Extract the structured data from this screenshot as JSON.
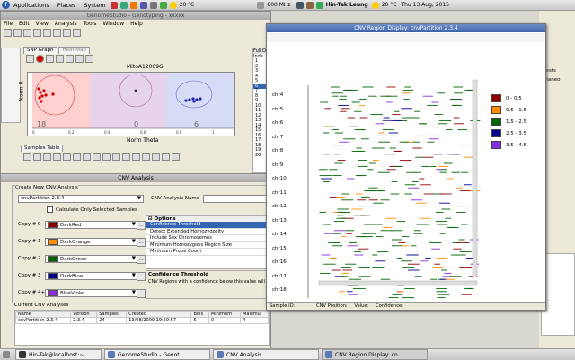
{
  "top_panel": {
    "menus": [
      "Applications",
      "Places",
      "System"
    ],
    "weather": "20 °C",
    "cpu": "800 MHz",
    "user": "Hin-Tak Leung",
    "weather2": "20 °C",
    "clock": "Thu 13 Aug, 2015"
  },
  "genome_studio": {
    "title": "GenomeStudio - Genotyping - xxxxx",
    "menus": [
      "File",
      "Edit",
      "View",
      "Analysis",
      "Tools",
      "Window",
      "Help"
    ],
    "tabs": [
      "SNP Graph",
      "Heat Map"
    ],
    "snp_name": "MitoA12009G",
    "y_axis": "Norm R",
    "x_axis": "Norm Theta",
    "cluster_counts": [
      "18",
      "0",
      "6"
    ],
    "x_ticks": [
      "0",
      "0.2",
      "0.4",
      "0.6",
      "0.8",
      "1"
    ],
    "samples_tab": "Samples Table",
    "right_header": "Full D",
    "index_header": "Inde",
    "index_rows": [
      "1",
      "2",
      "3",
      "4",
      "5",
      "6",
      "7",
      "8",
      "9",
      "10",
      "11",
      "12",
      "13",
      "14",
      "15",
      "16",
      "17",
      "18",
      "19",
      "20"
    ],
    "far_right_text": [
      "ntests",
      "celaneo"
    ]
  },
  "cnv_analysis": {
    "title": "CNV Analysis",
    "group_title": "Create New CNV Analysis",
    "plugin_select": "cnvPartition 2.3.4",
    "name_label": "CNV Analysis Name",
    "name_value": "",
    "checkbox_label": "Calculate Only Selected Samples",
    "copies": [
      {
        "label": "Copy # 0",
        "color_name": "DarkRed",
        "color": "#8b0000"
      },
      {
        "label": "Copy # 1",
        "color_name": "DarkOrange",
        "color": "#ff8c00"
      },
      {
        "label": "Copy # 2",
        "color_name": "DarkGreen",
        "color": "#006400"
      },
      {
        "label": "Copy # 3",
        "color_name": "DarkBlue",
        "color": "#00008b"
      },
      {
        "label": "Copy # 4+",
        "color_name": "BlueViolet",
        "color": "#8a2be2"
      }
    ],
    "options_title": "Options",
    "options": [
      "Confidence Threshold",
      "Detect Extended Homozygosity",
      "Include Sex Chromosomes",
      "Minimum Homozygous Region Size",
      "Minimum Probe Count"
    ],
    "selected_option": "Confidence Threshold",
    "desc_title": "Confidence Threshold",
    "desc_text": "CNV Regions with a confidence below this value will",
    "current_title": "Current CNV Analyses",
    "table_headers": [
      "Name",
      "Version",
      "Samples",
      "Created",
      "Bins",
      "Minimum",
      "Maximu"
    ],
    "table_rows": [
      [
        "cnvPartition 2.3.4",
        "2.3.4",
        "24",
        "13/08/2009 19:59:57",
        "5",
        "0",
        "4"
      ]
    ]
  },
  "region_display": {
    "title": "CNV Region Display: cnvPartition 2.3.4",
    "chromosomes": [
      "chr4",
      "chr5",
      "chr6",
      "chr7",
      "chr8",
      "chr9",
      "chr10",
      "chr11",
      "chr12",
      "chr13",
      "chr14",
      "chr15",
      "chr16",
      "chr17",
      "chr18"
    ],
    "legend": [
      {
        "label": "0 - 0.5",
        "color": "#8b0000"
      },
      {
        "label": "0.5 - 1.5",
        "color": "#ff8c00"
      },
      {
        "label": "1.5 - 2.5",
        "color": "#006400"
      },
      {
        "label": "2.5 - 3.5",
        "color": "#00008b"
      },
      {
        "label": "3.5 - 4.5",
        "color": "#8a2be2"
      }
    ],
    "status": {
      "sample_id": "Sample ID:",
      "cnv_position": "CNV Position:",
      "value": "Value:",
      "confidence": "Confidence:"
    }
  },
  "taskbar": {
    "items": [
      "Hin-Tak@localhost:~",
      "GenomeStudio - Genot...",
      "CNV Analysis",
      "CNV Region Display: cn..."
    ],
    "active_index": 3
  }
}
